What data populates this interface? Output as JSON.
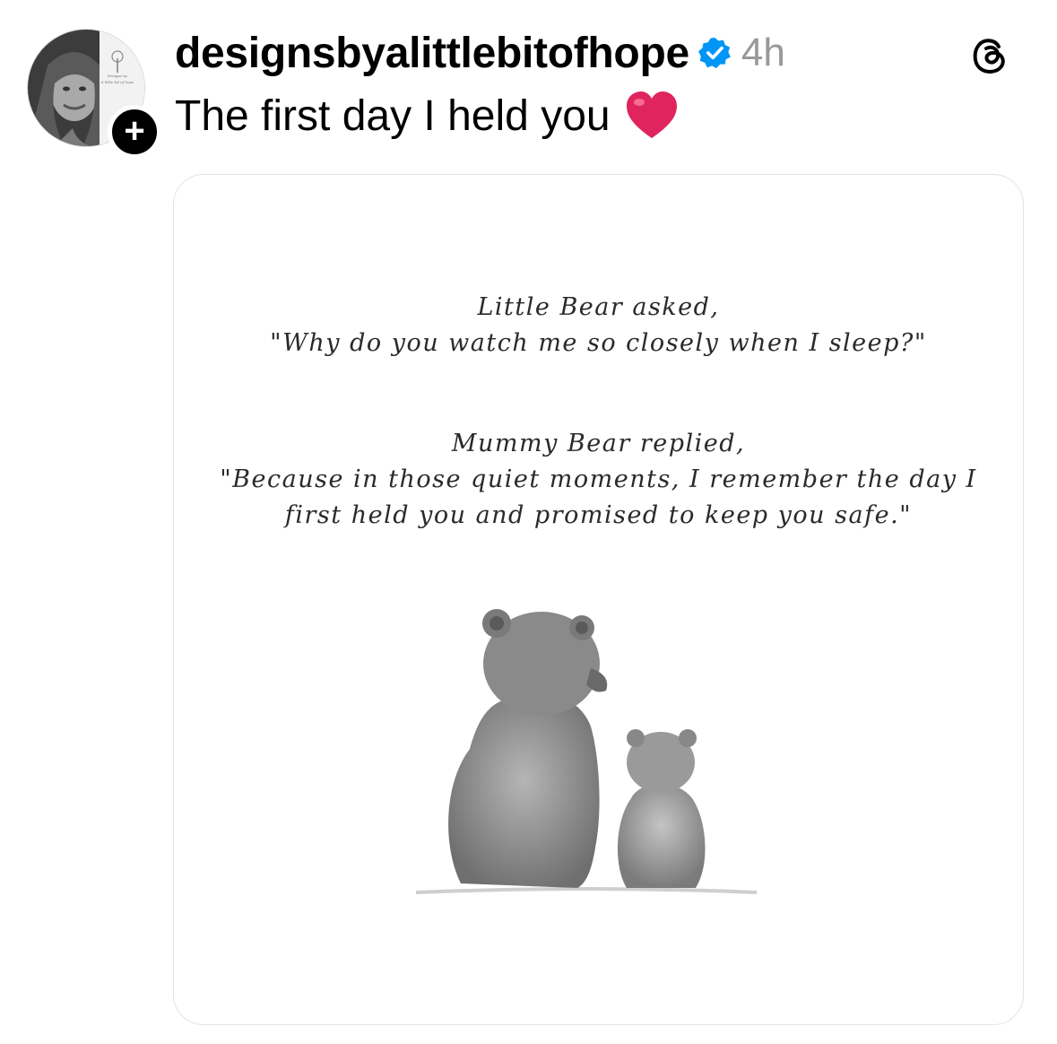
{
  "post": {
    "username": "designsbyalittlebitofhope",
    "verified": true,
    "time": "4h",
    "caption": "The first day I held you",
    "avatar": {
      "logo_text_top": "Designs by",
      "logo_text_bottom": "A little bit of hope"
    }
  },
  "image": {
    "stanza1": [
      "Little Bear asked,",
      "\"Why do you watch me so closely when I sleep?\""
    ],
    "stanza2": [
      "Mummy Bear replied,",
      "\"Because in those quiet moments, I remember the day I",
      "first held you and promised to keep you safe.\""
    ]
  },
  "colors": {
    "verified": "#0095f6",
    "time": "#999999",
    "heart": "#e0245e"
  },
  "icons": [
    "follow-plus-icon",
    "verified-badge-icon",
    "threads-logo-icon",
    "red-heart-emoji"
  ]
}
